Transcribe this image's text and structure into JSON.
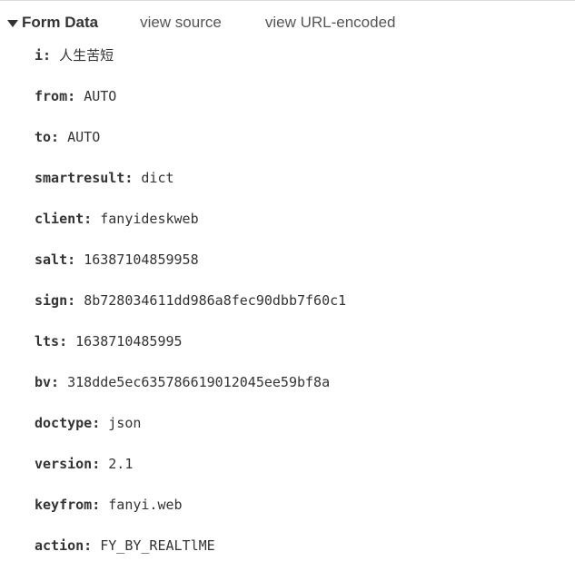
{
  "header": {
    "title": "Form Data",
    "view_source": "view source",
    "view_url_encoded": "view URL-encoded"
  },
  "fields": [
    {
      "key": "i",
      "value": "人生苦短",
      "cjk": true
    },
    {
      "key": "from",
      "value": "AUTO"
    },
    {
      "key": "to",
      "value": "AUTO"
    },
    {
      "key": "smartresult",
      "value": "dict"
    },
    {
      "key": "client",
      "value": "fanyideskweb"
    },
    {
      "key": "salt",
      "value": "16387104859958"
    },
    {
      "key": "sign",
      "value": "8b728034611dd986a8fec90dbb7f60c1"
    },
    {
      "key": "lts",
      "value": "1638710485995"
    },
    {
      "key": "bv",
      "value": "318dde5ec635786619012045ee59bf8a"
    },
    {
      "key": "doctype",
      "value": "json"
    },
    {
      "key": "version",
      "value": "2.1"
    },
    {
      "key": "keyfrom",
      "value": "fanyi.web"
    },
    {
      "key": "action",
      "value": "FY_BY_REALTlME"
    }
  ]
}
